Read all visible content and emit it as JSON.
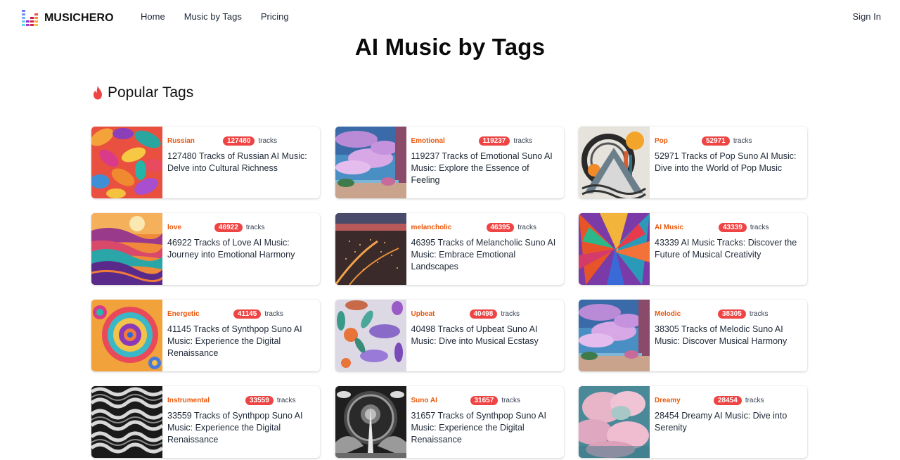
{
  "header": {
    "brand": "MUSICHERO",
    "logo_icon": "equalizer-bars-icon",
    "nav": [
      {
        "label": "Home"
      },
      {
        "label": "Music by Tags"
      },
      {
        "label": "Pricing"
      }
    ],
    "signin_label": "Sign In"
  },
  "page": {
    "title": "AI Music by Tags",
    "section_title": "Popular Tags",
    "section_icon": "fire-icon"
  },
  "colors": {
    "tag_text": "#ea580c",
    "badge_bg": "#ef4444",
    "badge_text": "#ffffff"
  },
  "cards": [
    {
      "tag": "Russian",
      "count": "127480",
      "unit": "tracks",
      "title": "127480 Tracks of Russian AI Music: Delve into Cultural Richness",
      "image": "colorful-abstract-swirls"
    },
    {
      "tag": "Emotional",
      "count": "119237",
      "unit": "tracks",
      "title": "119237 Tracks of Emotional Suno AI Music: Explore the Essence of Feeling",
      "image": "pink-clouds-seaside"
    },
    {
      "tag": "Pop",
      "count": "52971",
      "unit": "tracks",
      "title": "52971 Tracks of Pop Suno AI Music: Dive into the World of Pop Music",
      "image": "abstract-mountain-sun"
    },
    {
      "tag": "love",
      "count": "46922",
      "unit": "tracks",
      "title": "46922 Tracks of Love AI Music: Journey into Emotional Harmony",
      "image": "sunset-waves"
    },
    {
      "tag": "melancholic",
      "count": "46395",
      "unit": "tracks",
      "title": "46395 Tracks of Melancholic Suno AI Music: Embrace Emotional Landscapes",
      "image": "city-night-lights"
    },
    {
      "tag": "AI Music",
      "count": "43339",
      "unit": "tracks",
      "title": "43339 AI Music Tracks: Discover the Future of Musical Creativity",
      "image": "colorful-shards"
    },
    {
      "tag": "Energetic",
      "count": "41145",
      "unit": "tracks",
      "title": "41145 Tracks of Synthpop Suno AI Music: Experience the Digital Renaissance",
      "image": "psychedelic-spirals"
    },
    {
      "tag": "Upbeat",
      "count": "40498",
      "unit": "tracks",
      "title": "40498 Tracks of Upbeat Suno AI Music: Dive into Musical Ecstasy",
      "image": "fish-and-crabs-pattern"
    },
    {
      "tag": "Melodic",
      "count": "38305",
      "unit": "tracks",
      "title": "38305 Tracks of Melodic Suno AI Music: Discover Musical Harmony",
      "image": "pink-clouds-seaside"
    },
    {
      "tag": "Instrumental",
      "count": "33559",
      "unit": "tracks",
      "title": "33559 Tracks of Synthpop Suno AI Music: Experience the Digital Renaissance",
      "image": "monochrome-waves"
    },
    {
      "tag": "Suno AI",
      "count": "31657",
      "unit": "tracks",
      "title": "31657 Tracks of Synthpop Suno AI Music: Experience the Digital Renaissance",
      "image": "monochrome-portal"
    },
    {
      "tag": "Dreamy",
      "count": "28454",
      "unit": "tracks",
      "title": "28454 Dreamy AI Music: Dive into Serenity",
      "image": "pink-cloudscape"
    }
  ]
}
